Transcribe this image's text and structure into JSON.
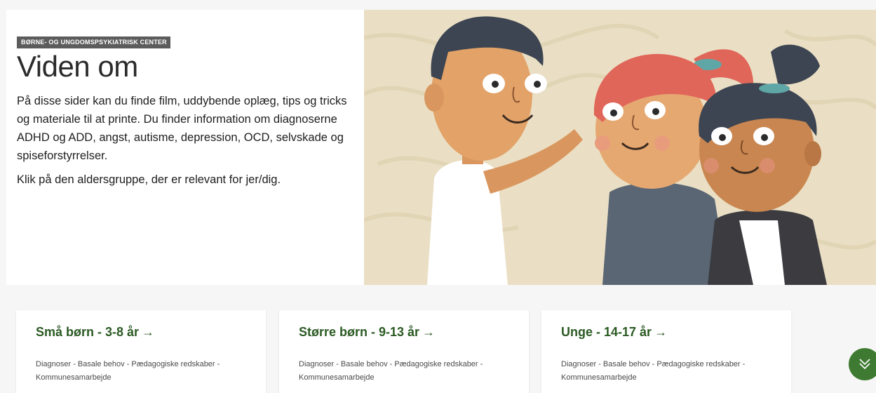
{
  "hero": {
    "badge": "BØRNE- OG UNGDOMSPSYKIATRISK CENTER",
    "title": "Viden om",
    "intro": "På disse sider kan du finde film, uddybende oplæg, tips og tricks og materiale til at printe. Du finder information om diagnoserne ADHD og ADD, angst, autisme, depression, OCD, selvskade og spiseforstyrrelser.",
    "instruction": "Klik på den aldersgruppe, der er relevant for jer/dig.",
    "image_icon": "three-cartoon-children-illustration"
  },
  "cards": [
    {
      "title": "Små børn - 3-8 år",
      "arrow": "→",
      "description": "Diagnoser - Basale behov - Pædagogiske redskaber - Kommunesamarbejde"
    },
    {
      "title": "Større børn - 9-13 år",
      "arrow": "→",
      "description": "Diagnoser - Basale behov - Pædagogiske redskaber - Kommunesamarbejde"
    },
    {
      "title": "Unge - 14-17 år",
      "arrow": "→",
      "description": "Diagnoser - Basale behov - Pædagogiske redskaber - Kommunesamarbejde"
    }
  ],
  "scroll_button": {
    "icon": "double-chevron-down-icon"
  },
  "colors": {
    "card_title": "#2b5a23",
    "scroll_button": "#3e7a31",
    "badge_bg": "#5c5c5c",
    "illustration_bg": "#eadfc4"
  }
}
